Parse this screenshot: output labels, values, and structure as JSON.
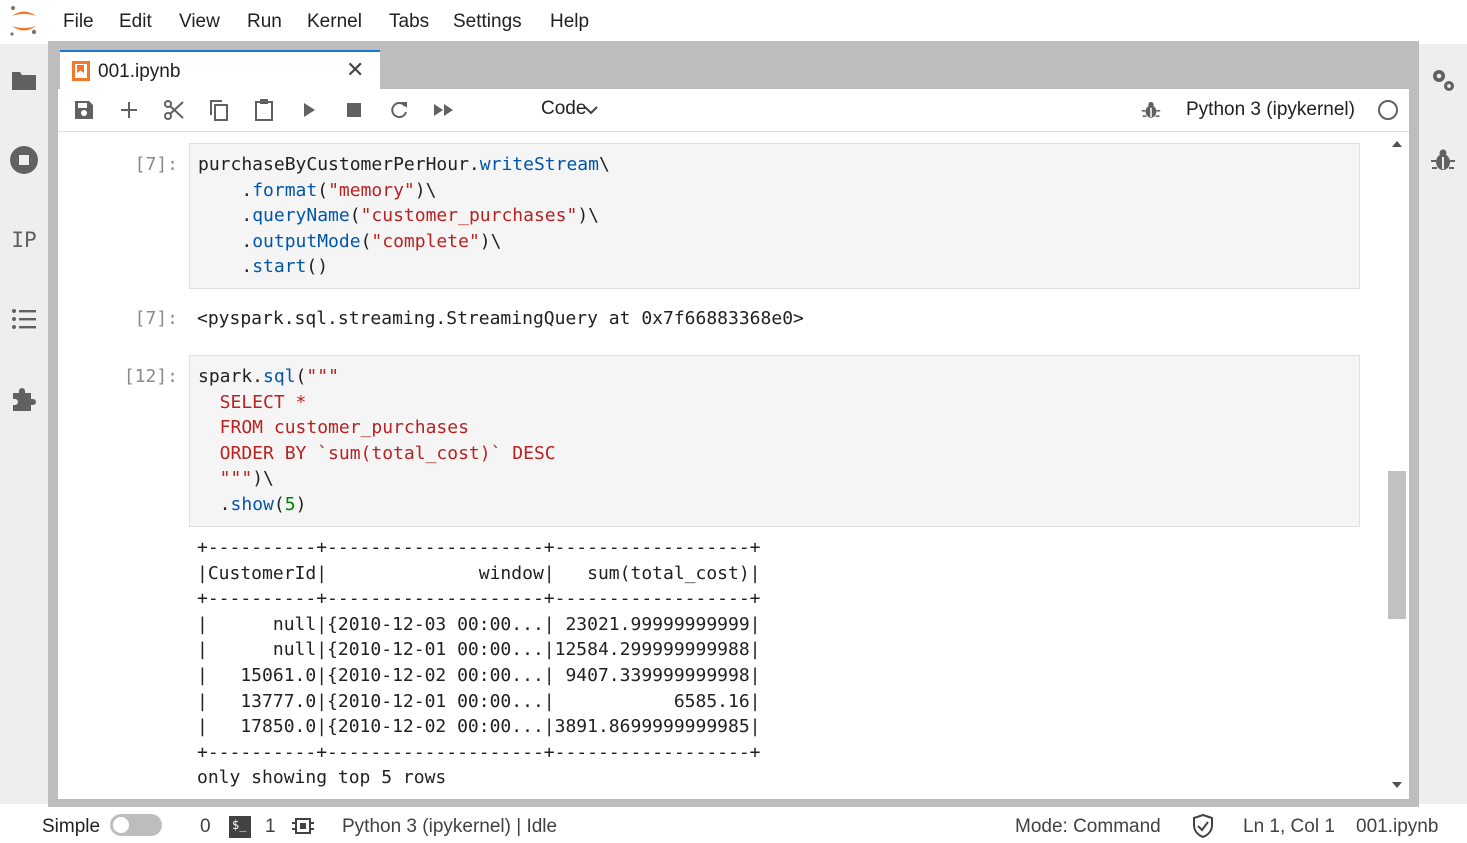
{
  "menu": {
    "items": [
      "File",
      "Edit",
      "View",
      "Run",
      "Kernel",
      "Tabs",
      "Settings",
      "Help"
    ]
  },
  "sidebar": {
    "left_icons": [
      "folder-icon",
      "stop-circle-icon",
      "property-inspector-icon",
      "table-of-contents-icon",
      "extension-icon"
    ],
    "ip_label": "IP",
    "right_icons": [
      "property-gears-icon",
      "debugger-bug-icon"
    ]
  },
  "tab": {
    "title": "001.ipynb",
    "close": "✕"
  },
  "toolbar": {
    "icons": [
      "save-icon",
      "add-icon",
      "cut-icon",
      "copy-icon",
      "paste-icon",
      "run-icon",
      "stop-icon",
      "restart-icon",
      "fast-forward-icon"
    ],
    "cell_type": "Code",
    "kernel": "Python 3 (ipykernel)"
  },
  "cells": [
    {
      "in_prompt": "[7]:",
      "out_prompt": "[7]:",
      "output": "<pyspark.sql.streaming.StreamingQuery at 0x7f66883368e0>"
    },
    {
      "in_prompt": "[12]:",
      "output": "+----------+--------------------+------------------+\n|CustomerId|              window|   sum(total_cost)|\n+----------+--------------------+------------------+\n|      null|{2010-12-03 00:00...| 23021.99999999999|\n|      null|{2010-12-01 00:00...|12584.299999999988|\n|   15061.0|{2010-12-02 00:00...| 9407.339999999998|\n|   13777.0|{2010-12-01 00:00...|           6585.16|\n|   17850.0|{2010-12-02 00:00...|3891.8699999999985|\n+----------+--------------------+------------------+\nonly showing top 5 rows"
    }
  ],
  "colors": {
    "accent": "#1976d2",
    "keyword": "#008000",
    "string": "#ba2121",
    "function": "#0055aa",
    "logo": "#f37726"
  },
  "status": {
    "mode_label": "Simple",
    "terminals": "0",
    "kernels": "1",
    "kernel_status": "Python 3 (ipykernel) | Idle",
    "mode": "Mode: Command",
    "cursor": "Ln 1, Col 1",
    "file": "001.ipynb"
  }
}
